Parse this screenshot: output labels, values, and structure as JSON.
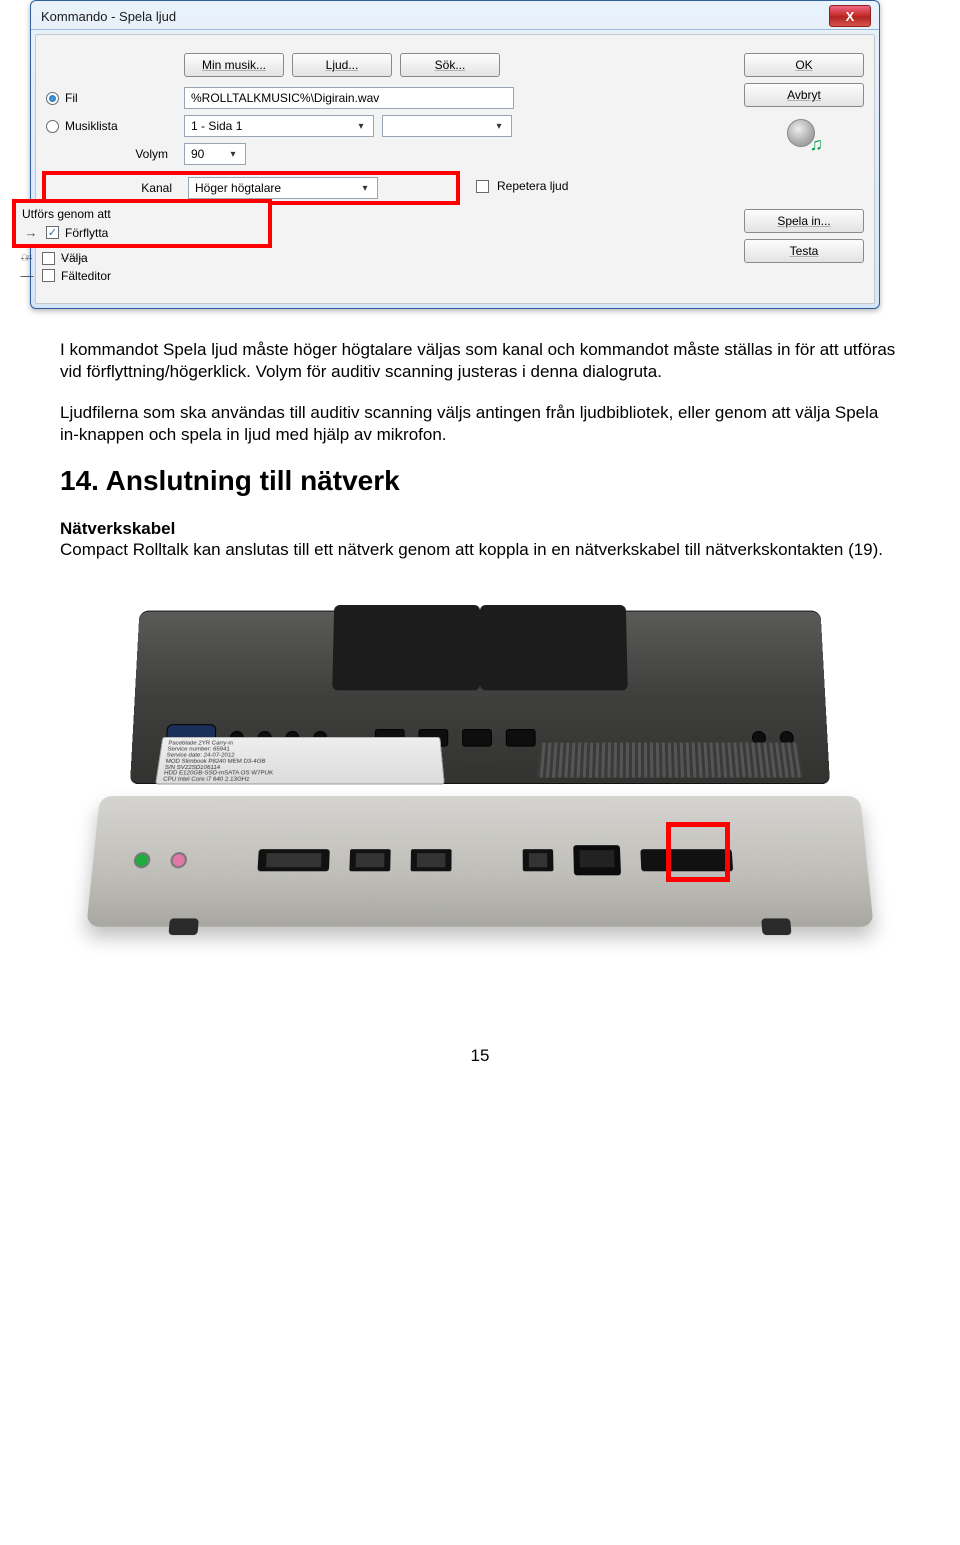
{
  "dialog": {
    "title": "Kommando - Spela ljud",
    "close_glyph": "X",
    "buttons": {
      "ok": "OK",
      "cancel": "Avbryt",
      "record": "Spela in...",
      "test": "Testa",
      "min_musik": "Min musik...",
      "ljud": "Ljud...",
      "sok": "Sök..."
    },
    "radio_fil": "Fil",
    "radio_musiklista": "Musiklista",
    "fil_value": "%ROLLTALKMUSIC%\\Digirain.wav",
    "musiklista_value": "1 - Sida 1",
    "volym_label": "Volym",
    "volym_value": "90",
    "kanal_label": "Kanal",
    "kanal_value": "Höger högtalare",
    "repetera_label": "Repetera ljud",
    "utfors_label": "Utförs genom att",
    "forflytta": "Förflytta",
    "valja": "Välja",
    "falteditor": "Fälteditor",
    "arrow_glyph": "→",
    "hand_glyph": "☞",
    "dash_glyph": "—"
  },
  "text": {
    "p1": "I kommandot Spela ljud måste höger högtalare väljas som kanal och kommandot måste ställas in för att utföras vid förflyttning/högerklick. Volym för auditiv scanning justeras i denna dialogruta.",
    "p2": "Ljudfilerna som ska användas till auditiv scanning väljs antingen från ljudbibliotek, eller genom att välja Spela in-knappen och spela in ljud med hjälp av mikrofon.",
    "h1": "14. Anslutning till nätverk",
    "sub": "Nätverkskabel",
    "p3": "Compact Rolltalk kan anslutas till ett nätverk genom att koppla in en nätverkskabel till nätverkskontakten (19)."
  },
  "sticker": {
    "l1": "Paceblade 2YR Carry-in",
    "l2": "Service number: 65941",
    "l3": "Service date: 24-07-2012",
    "l4": "MOD Slimbook P8240  MEM D3-4GB",
    "l5": "S/N SV22SD106114",
    "l6": "HDD E120GB-SSD-mSATA  OS W7PUK",
    "l7": "CPU Intel Core i7  640 2.13GHz"
  },
  "page_number": "15"
}
